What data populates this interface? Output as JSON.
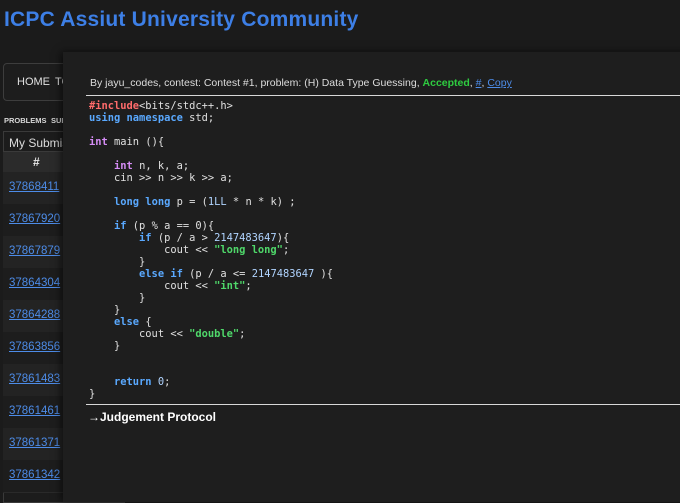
{
  "site": {
    "title": "ICPC Assiut University Community"
  },
  "nav": {
    "items": [
      "HOME",
      "TO"
    ]
  },
  "sub_nav": {
    "items": [
      "PROBLEMS",
      "SUB"
    ]
  },
  "submissions": {
    "heading": "My Submis",
    "column_header": "#",
    "ids": [
      "37868411",
      "37867920",
      "37867879",
      "37864304",
      "37864288",
      "37863856",
      "37861483",
      "37861461",
      "37861371",
      "37861342"
    ]
  },
  "modal": {
    "by_prefix": "By ",
    "author": "jayu_codes",
    "contest_prefix": ", contest: ",
    "contest": "Contest #1",
    "problem_prefix": ", problem: ",
    "problem": "(H) Data Type Guessing",
    "sep": ", ",
    "verdict": "Accepted",
    "hash_link": "#",
    "copy_link": "Copy",
    "judgement_title": "→Judgement Protocol"
  },
  "code_tokens": {
    "include": "#include",
    "header": "<bits/stdc++.h>",
    "using": "using",
    "namespace": "namespace",
    "std": " std;",
    "int": "int",
    "main": " main (){",
    "decl": " n, k, a;",
    "cin": "    cin >> n >> k >> a;",
    "long_long": "long long",
    "p_decl": " p = (",
    "ll1": "1LL",
    "p_decl_rest": " * n * k) ;",
    "if": "if",
    "cond1": " (p % a == 0){",
    "cond2_a": " (p / a > ",
    "big": "2147483647",
    "cond2_b": "){",
    "cout": "cout << ",
    "s_longlong": "\"long long\"",
    "semi": ";",
    "close": "}",
    "else": "else",
    "cond3_a": " (p / a <= ",
    "cond3_b": " ){",
    "s_int": "\"int\"",
    "open": " {",
    "s_double": "\"double\"",
    "return": "return",
    "zero": "0",
    "ret_rest": ";"
  },
  "colors": {
    "title_blue": "#3d7fe6",
    "accepted_green": "#2ecc40",
    "link_blue": "#4d8ce8",
    "keyword_blue": "#5aa9ff",
    "keyword_purple": "#d58cf5",
    "preprocessor_red": "#ff6b6b",
    "string_green": "#4fd86a"
  }
}
